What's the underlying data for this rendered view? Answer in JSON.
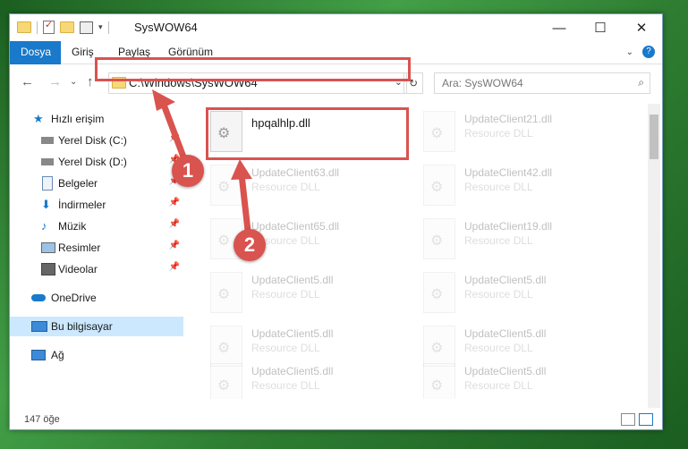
{
  "window": {
    "title": "SysWOW64"
  },
  "ribbon": {
    "tabs": [
      "Dosya",
      "Giriş",
      "Paylaş",
      "Görünüm"
    ]
  },
  "address": {
    "path": "C:\\Windows\\SysWOW64"
  },
  "search": {
    "placeholder": "Ara: SysWOW64"
  },
  "sidebar": {
    "items": [
      {
        "label": "Hızlı erişim",
        "icon": "star-icon"
      },
      {
        "label": "Yerel Disk (C:)",
        "icon": "drive-icon"
      },
      {
        "label": "Yerel Disk (D:)",
        "icon": "drive-icon"
      },
      {
        "label": "Belgeler",
        "icon": "documents-icon"
      },
      {
        "label": "İndirmeler",
        "icon": "download-icon"
      },
      {
        "label": "Müzik",
        "icon": "music-icon"
      },
      {
        "label": "Resimler",
        "icon": "pictures-icon"
      },
      {
        "label": "Videolar",
        "icon": "videos-icon"
      },
      {
        "label": "OneDrive",
        "icon": "cloud-icon"
      },
      {
        "label": "Bu bilgisayar",
        "icon": "computer-icon"
      },
      {
        "label": "Ağ",
        "icon": "network-icon"
      }
    ]
  },
  "files": [
    {
      "name": "hpqalhlp.dll",
      "type": ""
    },
    {
      "name": "UpdateClient21.dll",
      "type": "Resource DLL"
    },
    {
      "name": "UpdateClient63.dll",
      "type": "Resource DLL"
    },
    {
      "name": "UpdateClient42.dll",
      "type": "Resource DLL"
    },
    {
      "name": "UpdateClient65.dll",
      "type": "Resource DLL"
    },
    {
      "name": "UpdateClient19.dll",
      "type": "Resource DLL"
    },
    {
      "name": "UpdateClient5.dll",
      "type": "Resource DLL"
    },
    {
      "name": "UpdateClient5.dll",
      "type": "Resource DLL"
    },
    {
      "name": "UpdateClient5.dll",
      "type": "Resource DLL"
    },
    {
      "name": "UpdateClient5.dll",
      "type": "Resource DLL"
    },
    {
      "name": "UpdateClient5.dll",
      "type": "Resource DLL"
    },
    {
      "name": "UpdateClient5.dll",
      "type": "Resource DLL"
    }
  ],
  "status": {
    "count": "147 öğe"
  },
  "annotations": {
    "badge1": "1",
    "badge2": "2",
    "color": "#d9534f"
  }
}
